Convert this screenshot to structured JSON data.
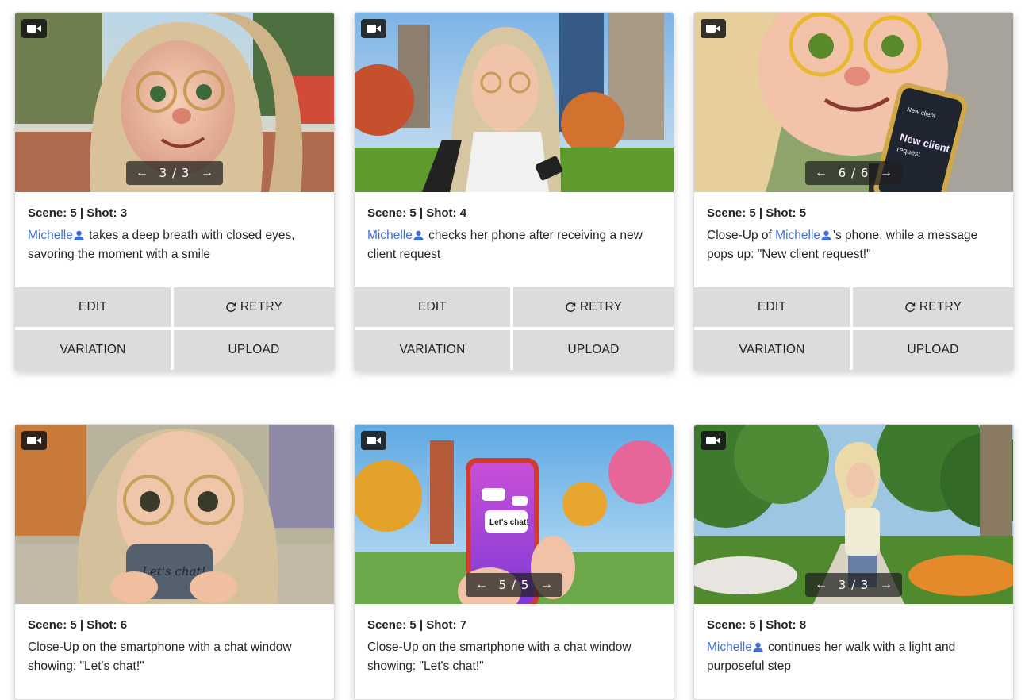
{
  "cards": [
    {
      "scene_label": "Scene: 5 | Shot: 3",
      "char": "Michelle",
      "before": "",
      "after": " takes a deep breath with closed eyes, savoring the moment with a smile",
      "pager": "3 / 3",
      "has_pager": true
    },
    {
      "scene_label": "Scene: 5 | Shot: 4",
      "char": "Michelle",
      "before": "",
      "after": " checks her phone after receiving a new client request",
      "pager": "",
      "has_pager": false
    },
    {
      "scene_label": "Scene: 5 | Shot: 5",
      "char": "Michelle",
      "before": "Close-Up of ",
      "after": "'s phone, while a message pops up: \"New client request!\"",
      "pager": "6 / 6",
      "has_pager": true
    },
    {
      "scene_label": "Scene: 5 | Shot: 6",
      "char": "",
      "before": "Close-Up on the smartphone with a chat window showing: \"Let's chat!\"",
      "after": "",
      "pager": "",
      "has_pager": false
    },
    {
      "scene_label": "Scene: 5 | Shot: 7",
      "char": "",
      "before": "Close-Up on the smartphone with a chat window showing: \"Let's chat!\"",
      "after": "",
      "pager": "5 / 5",
      "has_pager": true
    },
    {
      "scene_label": "Scene: 5 | Shot: 8",
      "char": "Michelle",
      "before": "",
      "after": " continues her walk with a light and purposeful step",
      "pager": "3 / 3",
      "has_pager": true
    }
  ],
  "buttons": {
    "edit": "EDIT",
    "retry": "RETRY",
    "variation": "VARIATION",
    "upload": "UPLOAD"
  },
  "image_text": {
    "phone_new_client": "New client",
    "phone_request": "request",
    "phone_header": "New client",
    "chat_bubble": "Let's chat!",
    "phone_case_text": "Let's chat!"
  },
  "colors": {
    "character_link": "#3f6fd8",
    "button_bg": "#dcdcdc"
  }
}
